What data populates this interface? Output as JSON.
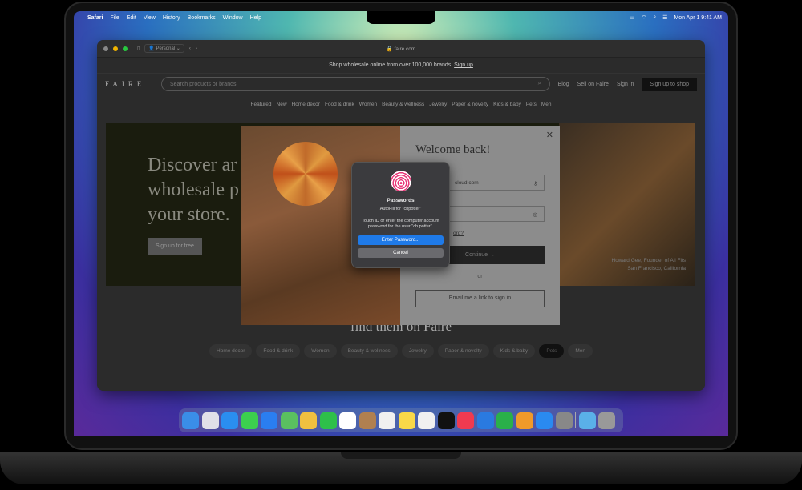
{
  "menubar": {
    "apple": "",
    "app": "Safari",
    "items": [
      "File",
      "Edit",
      "View",
      "History",
      "Bookmarks",
      "Window",
      "Help"
    ],
    "clock": "Mon Apr 1  9:41 AM"
  },
  "safari": {
    "profile": "Personal",
    "url": "faire.com"
  },
  "page": {
    "banner": "Shop wholesale online from over 100,000 brands.",
    "banner_link": "Sign up",
    "logo": "FAIRE",
    "search_placeholder": "Search products or brands",
    "nav": [
      "Blog",
      "Sell on Faire",
      "Sign in"
    ],
    "signup": "Sign up to shop",
    "categories": [
      "Featured",
      "New",
      "Home decor",
      "Food & drink",
      "Women",
      "Beauty & wellness",
      "Jewelry",
      "Paper & novelty",
      "Kids & baby",
      "Pets",
      "Men"
    ],
    "hero_title": "Discover and buy wholesale products for your store.",
    "hero_title_visible": "Discover ar wholesale p your store.",
    "hero_button": "Sign up for free",
    "quote_name": "Howard Gee, Founder of All Fits",
    "quote_place": "San Francisco, California",
    "find": "find them on Faire",
    "pills": [
      "Home decor",
      "Food & drink",
      "Women",
      "Beauty & wellness",
      "Jewelry",
      "Paper & novelty",
      "Kids & baby",
      "Pets",
      "Men"
    ],
    "selected_pill": "Pets"
  },
  "modal": {
    "title": "Welcome back!",
    "email_value": "cloud.com",
    "forgot": "ord?",
    "continue": "Continue →",
    "or": "or",
    "email_link": "Email me a link to sign in"
  },
  "dialog": {
    "title": "Passwords",
    "subtitle": "AutoFill for \"cbpotter\"",
    "message": "Touch ID or enter the computer account password for the user \"cb potter\".",
    "primary": "Enter Password...",
    "cancel": "Cancel",
    "accent": "#1f7ae8"
  },
  "dock": [
    {
      "name": "finder",
      "color": "#3a8ee8"
    },
    {
      "name": "launchpad",
      "color": "#e0e0e8"
    },
    {
      "name": "safari",
      "color": "#2a8ef0"
    },
    {
      "name": "messages",
      "color": "#3ccf4e"
    },
    {
      "name": "mail",
      "color": "#2a7ef0"
    },
    {
      "name": "maps",
      "color": "#5ac060"
    },
    {
      "name": "photos",
      "color": "#f0c040"
    },
    {
      "name": "facetime",
      "color": "#2ec04a"
    },
    {
      "name": "calendar",
      "color": "#ffffff"
    },
    {
      "name": "contacts",
      "color": "#b08050"
    },
    {
      "name": "reminders",
      "color": "#f0f0f0"
    },
    {
      "name": "notes",
      "color": "#f8d848"
    },
    {
      "name": "freeform",
      "color": "#f0f0f0"
    },
    {
      "name": "tv",
      "color": "#111111"
    },
    {
      "name": "music",
      "color": "#f03a50"
    },
    {
      "name": "keynote",
      "color": "#2a7ae0"
    },
    {
      "name": "numbers",
      "color": "#2ab04a"
    },
    {
      "name": "pages",
      "color": "#f09a2a"
    },
    {
      "name": "app-store",
      "color": "#2a8af0"
    },
    {
      "name": "system-settings",
      "color": "#888888"
    },
    {
      "name": "downloads",
      "color": "#5ab0e8"
    },
    {
      "name": "trash",
      "color": "#999999"
    }
  ]
}
